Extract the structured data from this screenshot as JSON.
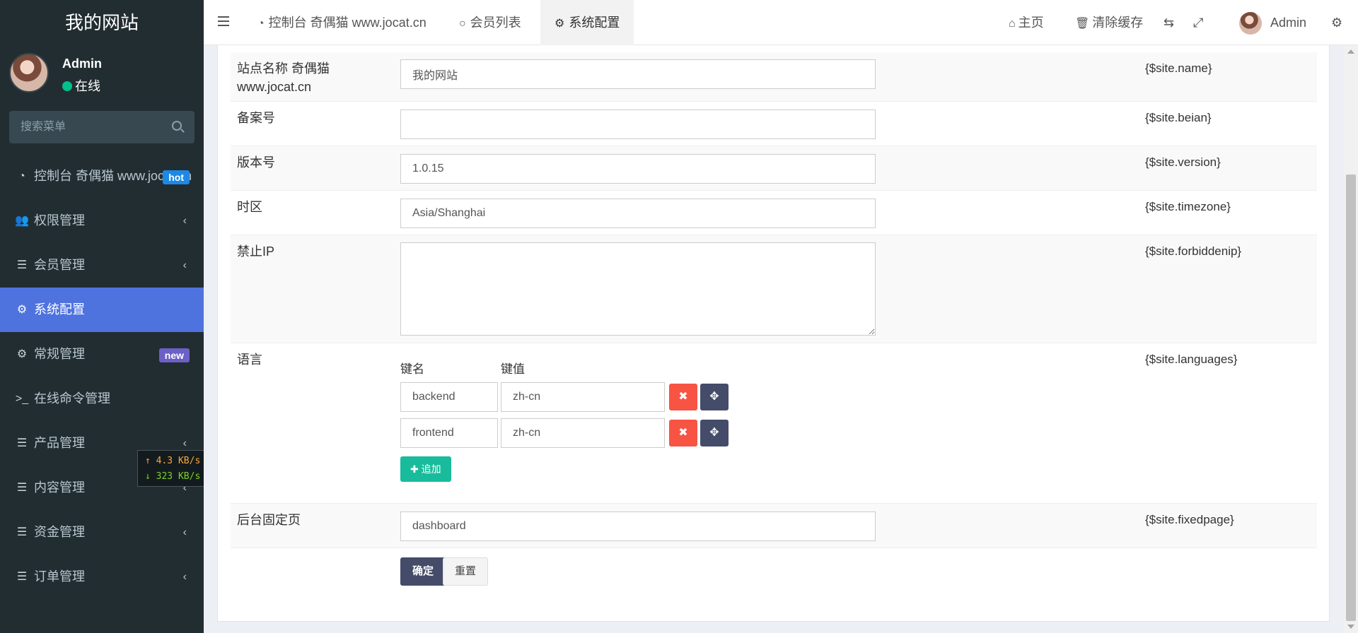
{
  "sidebar": {
    "logo": "我的网站",
    "user": {
      "name": "Admin",
      "status": "在线"
    },
    "search": {
      "placeholder": "搜索菜单"
    },
    "items": [
      {
        "label": "控制台 奇偶猫 www.jocat.cn",
        "badge": "hot"
      },
      {
        "label": "权限管理"
      },
      {
        "label": "会员管理"
      },
      {
        "label": "系统配置"
      },
      {
        "label": "常规管理",
        "badge": "new"
      },
      {
        "label": "在线命令管理"
      },
      {
        "label": "产品管理"
      },
      {
        "label": "内容管理"
      },
      {
        "label": "资金管理"
      },
      {
        "label": "订单管理"
      }
    ],
    "speed": {
      "up": "4.3 KB/s",
      "down": "323 KB/s"
    }
  },
  "header": {
    "tabs": [
      {
        "label": "控制台 奇偶猫 www.jocat.cn"
      },
      {
        "label": "会员列表"
      },
      {
        "label": "系统配置"
      }
    ],
    "home": "主页",
    "clear_cache": "清除缓存",
    "admin": "Admin"
  },
  "form": {
    "site_name": {
      "label": "站点名称 奇偶猫 www.jocat.cn",
      "value": "我的网站",
      "var": "{$site.name}"
    },
    "beian": {
      "label": "备案号",
      "value": "",
      "var": "{$site.beian}"
    },
    "version": {
      "label": "版本号",
      "value": "1.0.15",
      "var": "{$site.version}"
    },
    "timezone": {
      "label": "时区",
      "value": "Asia/Shanghai",
      "var": "{$site.timezone}"
    },
    "forbiddenip": {
      "label": "禁止IP",
      "value": "",
      "var": "{$site.forbiddenip}"
    },
    "languages": {
      "label": "语言",
      "var": "{$site.languages}",
      "key_header": "键名",
      "value_header": "键值",
      "rows": [
        {
          "key": "backend",
          "value": "zh-cn"
        },
        {
          "key": "frontend",
          "value": "zh-cn"
        }
      ],
      "add_label": "追加"
    },
    "fixedpage": {
      "label": "后台固定页",
      "value": "dashboard",
      "var": "{$site.fixedpage}"
    },
    "submit_label": "确定",
    "reset_label": "重置"
  }
}
